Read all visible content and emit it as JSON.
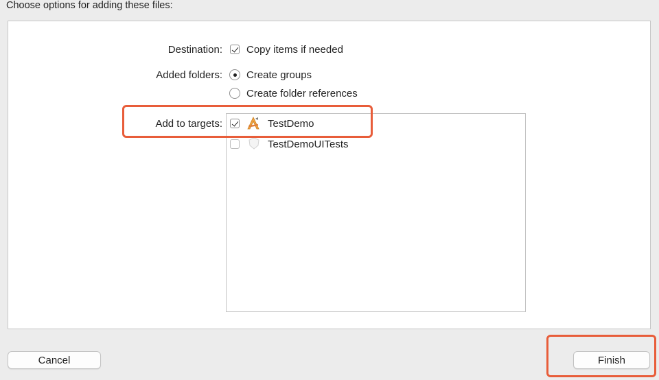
{
  "dialog": {
    "header": "Choose options for adding these files:"
  },
  "destination": {
    "label": "Destination:",
    "option_label": "Copy items if needed",
    "checked": true
  },
  "added_folders": {
    "label": "Added folders:",
    "options": [
      {
        "label": "Create groups",
        "selected": true
      },
      {
        "label": "Create folder references",
        "selected": false
      }
    ]
  },
  "targets": {
    "label": "Add to targets:",
    "items": [
      {
        "name": "TestDemo",
        "checked": true,
        "icon": "app-target-icon"
      },
      {
        "name": "TestDemoUITests",
        "checked": false,
        "icon": "test-target-icon"
      }
    ]
  },
  "buttons": {
    "cancel": "Cancel",
    "finish": "Finish"
  },
  "colors": {
    "highlight": "#e85d3a",
    "panel_bg": "#ffffff",
    "window_bg": "#ececec"
  }
}
